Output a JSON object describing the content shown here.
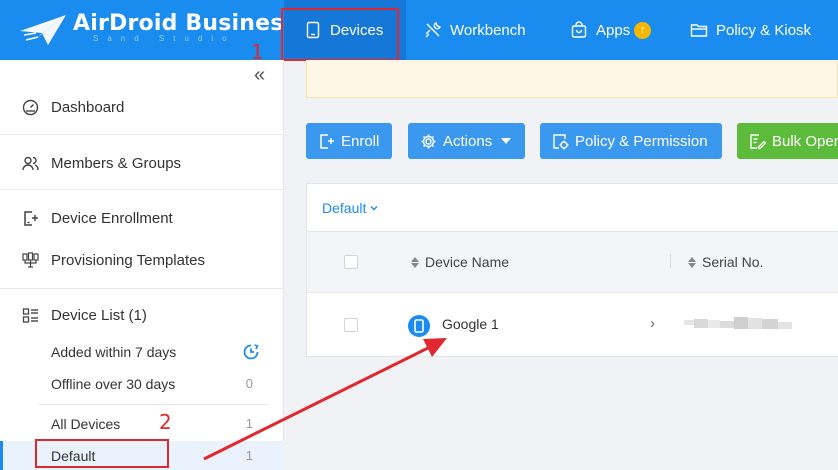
{
  "brand": {
    "name": "AirDroid Business",
    "subtitle": "Sand Studio"
  },
  "nav": {
    "tabs": [
      {
        "label": "Devices",
        "icon": "tablet-icon",
        "active": true
      },
      {
        "label": "Workbench",
        "icon": "tools-icon"
      },
      {
        "label": "Apps",
        "icon": "shopping-bag-icon",
        "badge": "upgrade-arrow"
      },
      {
        "label": "Policy & Kiosk",
        "icon": "folder-icon"
      }
    ]
  },
  "annotations": {
    "step1": "1",
    "step2": "2"
  },
  "sidebar": {
    "collapse_glyph": "«",
    "items": [
      {
        "label": "Dashboard",
        "icon": "gauge-icon"
      },
      {
        "label": "Members & Groups",
        "icon": "people-icon"
      },
      {
        "label": "Device Enrollment",
        "icon": "device-add-icon"
      },
      {
        "label": "Provisioning Templates",
        "icon": "template-icon"
      },
      {
        "label": "Device List (1)",
        "icon": "list-icon"
      }
    ],
    "device_list": [
      {
        "label": "Added within 7 days",
        "count_icon": "clock-refresh-icon"
      },
      {
        "label": "Offline over 30 days",
        "count": "0"
      },
      {
        "label": "All Devices",
        "count": "1"
      },
      {
        "label": "Default",
        "count": "1",
        "active": true
      }
    ]
  },
  "toolbar": {
    "enroll": "Enroll",
    "actions": "Actions",
    "policy": "Policy & Permission",
    "bulk": "Bulk Operations"
  },
  "table": {
    "group_selector": "Default",
    "columns": [
      "Device Name",
      "Serial No."
    ],
    "rows": [
      {
        "device_name": "Google 1"
      }
    ]
  },
  "colors": {
    "topbar": "#1a8cf0",
    "button_blue": "#3a98ef",
    "button_green": "#5cbb3a",
    "annotation_red": "#e0282e"
  }
}
